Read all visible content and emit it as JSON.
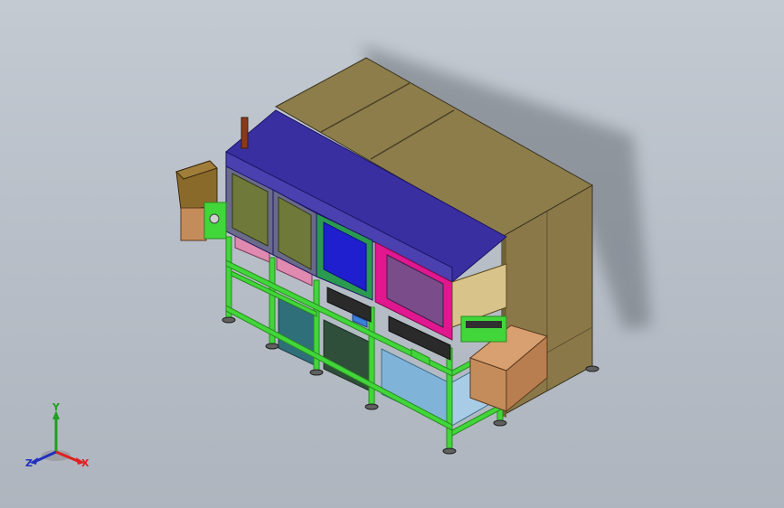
{
  "viewport": {
    "background_top": "#c3cad2",
    "background_bottom": "#aeb5be"
  },
  "model": {
    "colors": {
      "cabinet_top": "#8d7d4a",
      "cabinet_side": "#7d6c3c",
      "cabinet_end": "#8f7c4b",
      "hood_top": "#3a2fa1",
      "hood_front": "#3f3699",
      "frame": "#41d63a",
      "window_olive": "#6f7a3a",
      "window_blue": "#1f1fcf",
      "window_magenta": "#e0178f",
      "window_purple": "#7a4c8a",
      "tank_teal": "#2f6f7a",
      "tank_dark": "#2f4f3a",
      "tank_lightblue": "#7fb4d8",
      "box_tan": "#c48c5a",
      "pink_module": "#e08ab0"
    }
  },
  "triad": {
    "y_label": "Y",
    "x_label": "X",
    "z_label": "Z",
    "x_color": "#e02020",
    "y_color": "#20a020",
    "z_color": "#2030c0"
  }
}
